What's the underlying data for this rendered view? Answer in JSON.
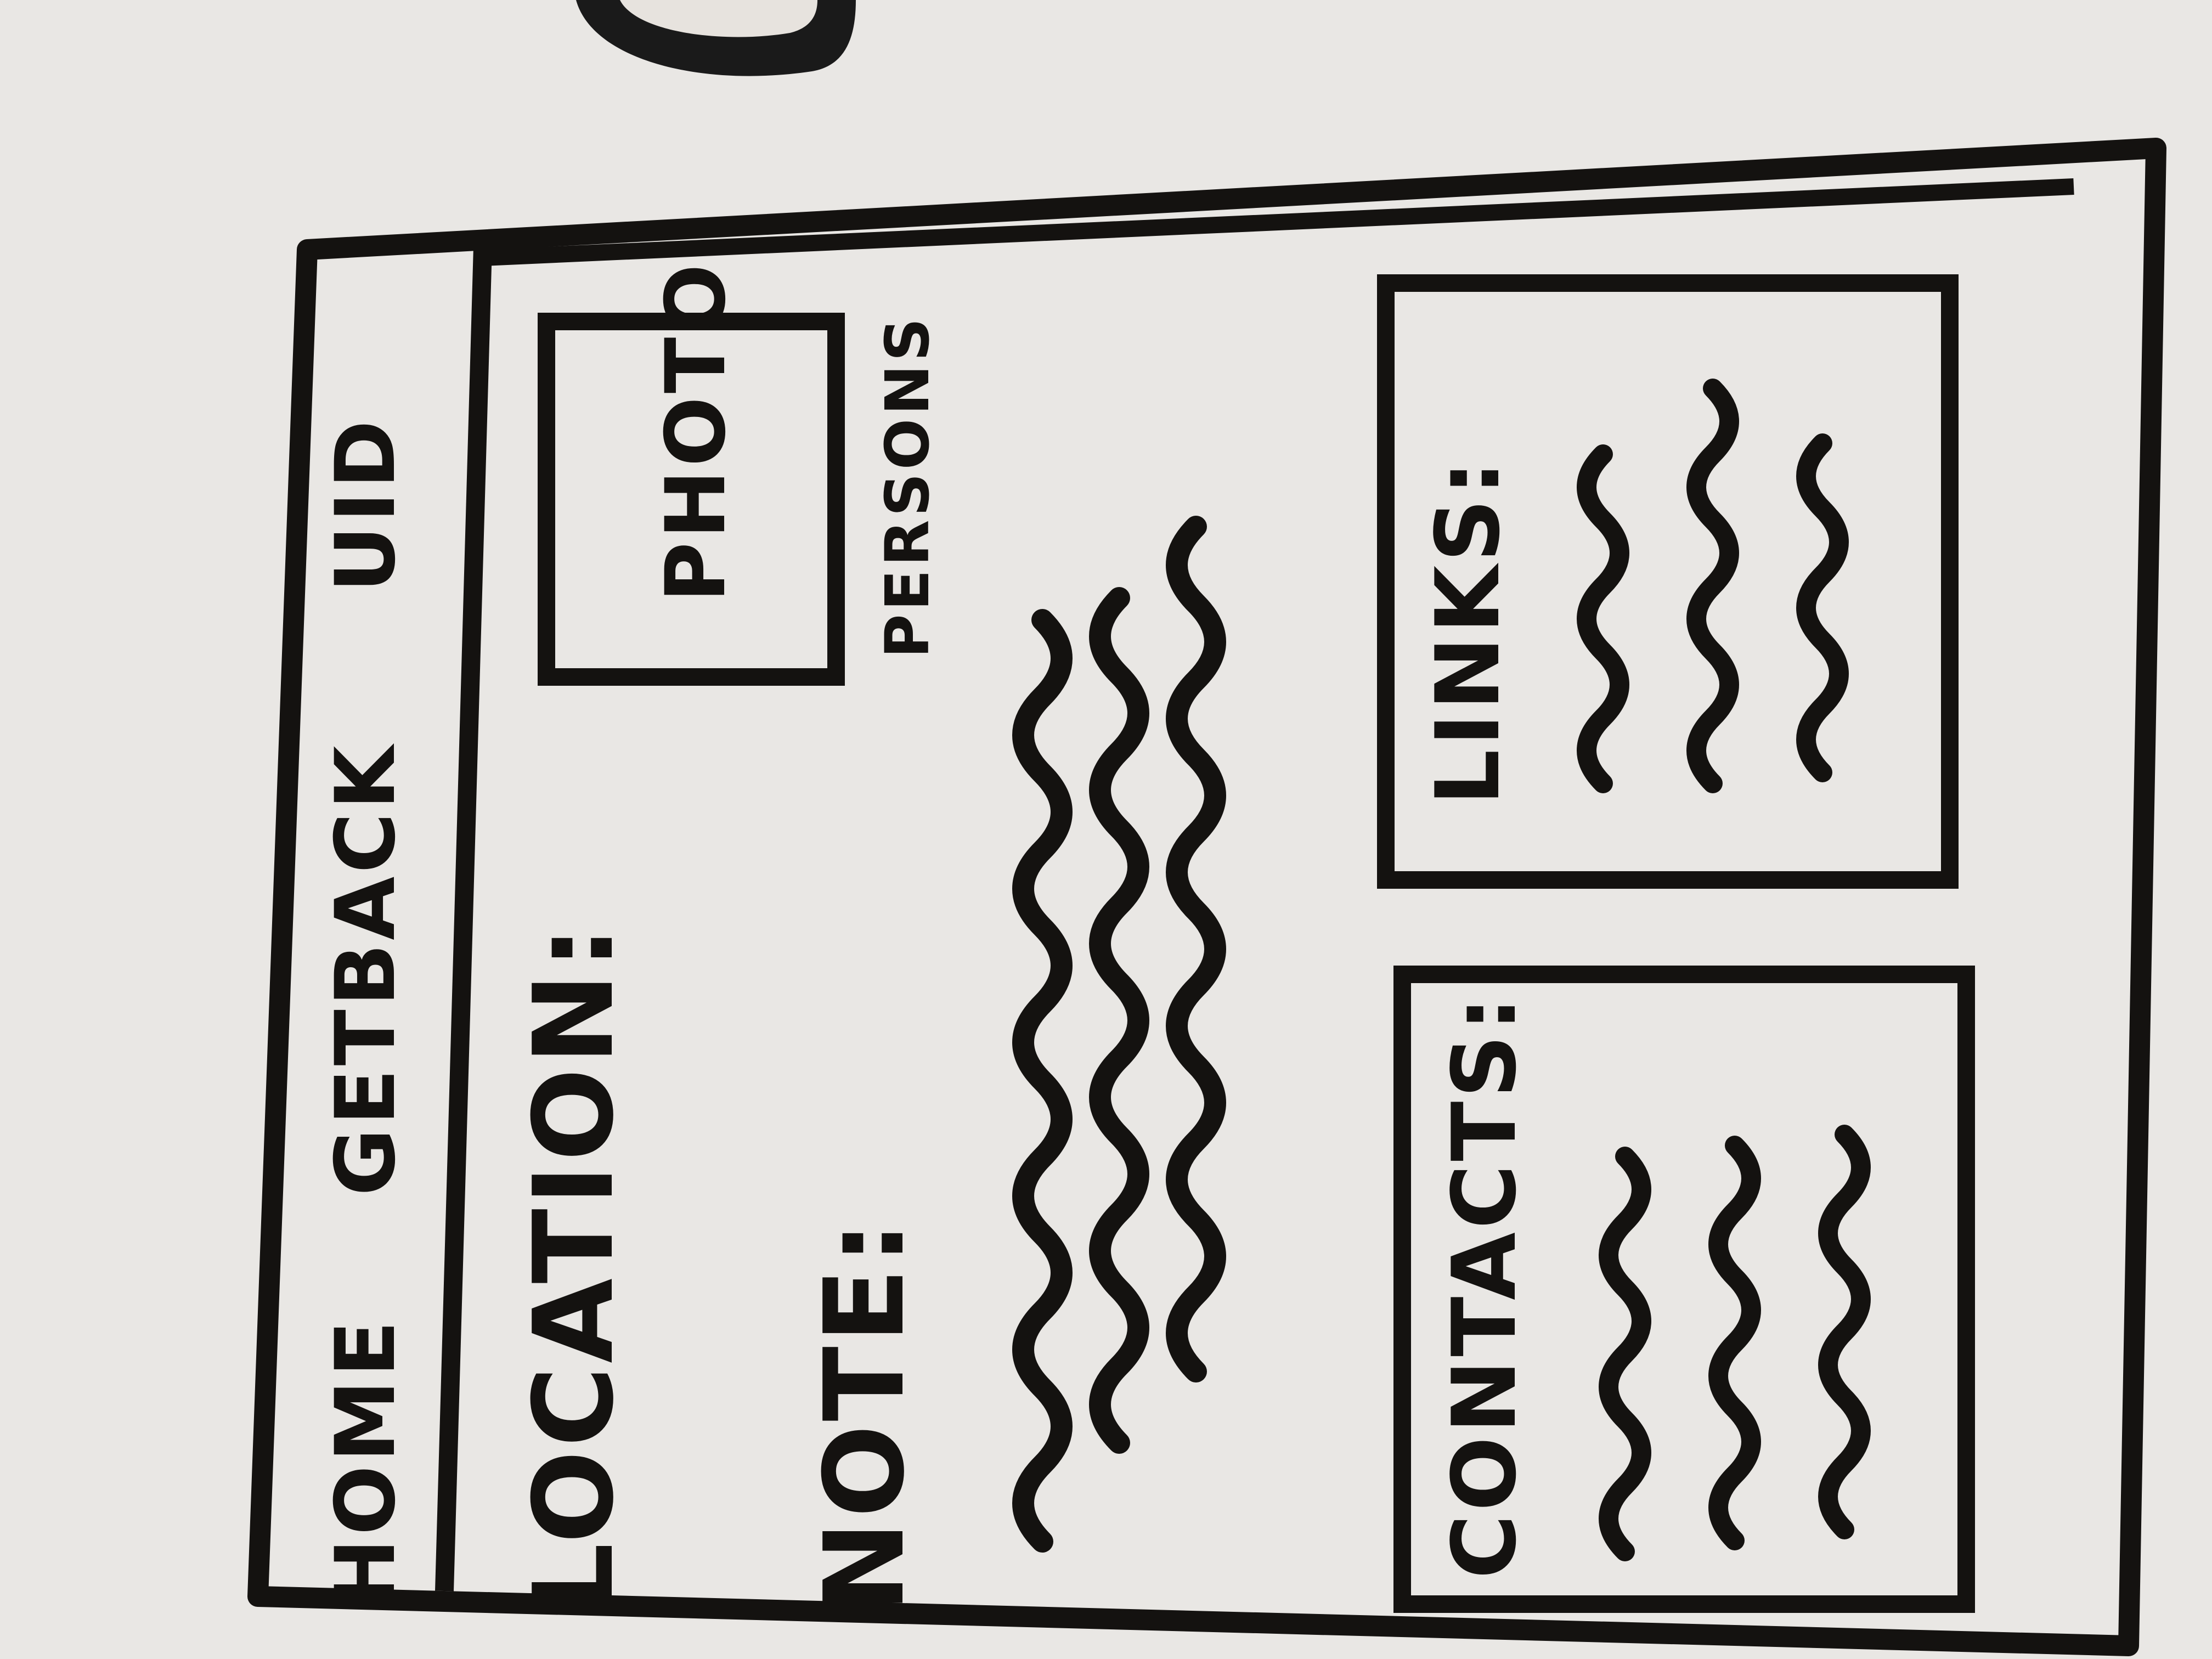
{
  "nav": {
    "items": [
      {
        "label": "HOME"
      },
      {
        "label": "GETBACK"
      },
      {
        "label": "UID"
      }
    ]
  },
  "main": {
    "location_label": "LOCATION:",
    "photo": {
      "label": "PHOTO",
      "caption": "PERSONS"
    },
    "note_label": "NOTE:"
  },
  "panels": {
    "contacts": {
      "title": "CONTACTS:"
    },
    "links": {
      "title": "LINKS:"
    }
  },
  "colors": {
    "ink": "#141210",
    "paper": "#e9e7e4"
  },
  "icons": {
    "scribble": "wavy-line-placeholder-icon"
  }
}
